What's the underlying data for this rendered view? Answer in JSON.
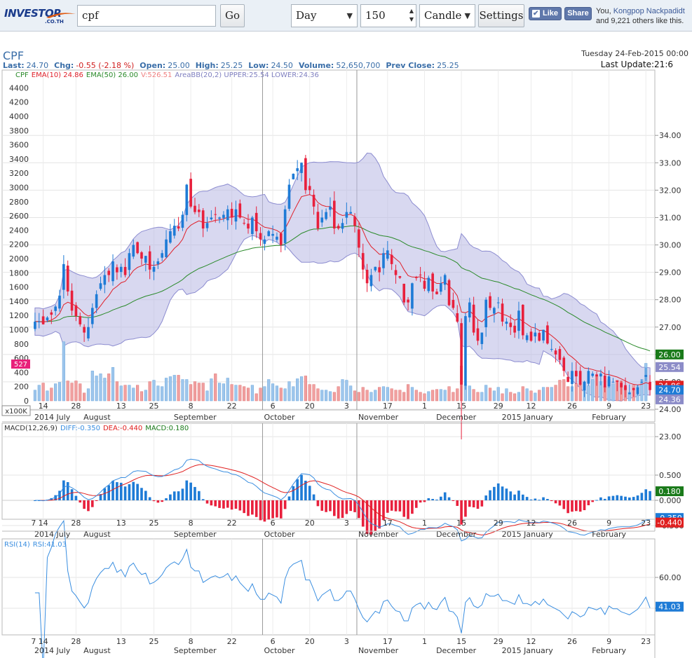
{
  "toolbar": {
    "logo_main": "INVESTOR",
    "logo_sub": ".CO.TH",
    "symbol_value": "cpf",
    "go_label": "Go",
    "period_value": "Day",
    "bars_value": "150",
    "style_value": "Candle",
    "settings_label": "Settings",
    "like_label": "Like",
    "share_label": "Share",
    "social_you": "You,",
    "social_name": "Kongpop Nackpadidt",
    "social_rest": "and 9,221 others like this."
  },
  "colors": {
    "up": "#1e7bd6",
    "down": "#e8203c",
    "ema10": "#e0202a",
    "ema50": "#2a8a2a",
    "band_fill": "#b8b8e4",
    "band_stroke": "#8c8cd0",
    "vol_up": "#9ec6ec",
    "vol_down": "#f0a0a0",
    "diff": "#3a8ee0",
    "dea": "#e02020",
    "rsi": "#3a8ee0",
    "header_text": "#3a6ea8"
  },
  "header": {
    "symbol": "CPF",
    "date": "Tuesday 24-Feb-2015 00:00",
    "last_update": "Last Update:21:6",
    "stats": [
      {
        "label": "Last:",
        "value": "24.70"
      },
      {
        "label": "Chg:",
        "value": "-0.55 (-2.18 %)",
        "negative": true
      },
      {
        "label": "Open:",
        "value": "25.00"
      },
      {
        "label": "High:",
        "value": "25.25"
      },
      {
        "label": "Low:",
        "value": "24.50"
      },
      {
        "label": "Volume:",
        "value": "52,650,700"
      },
      {
        "label": "Prev Close:",
        "value": "25.25"
      }
    ]
  },
  "price_panel": {
    "legend": [
      {
        "text": "CPF",
        "color": "#2a8a2a"
      },
      {
        "text": "EMA(10) 24.86",
        "color": "#e0202a"
      },
      {
        "text": "EMA(50) 26.00",
        "color": "#2a8a2a"
      },
      {
        "text": "V:526.51",
        "color": "#f08080"
      },
      {
        "text": "AreaBB(20,2) UPPER:25.54 LOWER:24.36",
        "color": "#8080c0"
      }
    ],
    "price_ticks": [
      "34.00",
      "33.00",
      "32.00",
      "31.00",
      "30.00",
      "29.00",
      "28.00",
      "27.00",
      "26.00",
      "25.00",
      "24.00",
      "23.00"
    ],
    "volume_ticks": [
      "4400",
      "4200",
      "4000",
      "3800",
      "3600",
      "3400",
      "3200",
      "3000",
      "2800",
      "2600",
      "2400",
      "2200",
      "2000",
      "1800",
      "1600",
      "1400",
      "1200",
      "1000",
      "800",
      "600",
      "400",
      "200",
      "0"
    ],
    "volume_unit": "x100K",
    "volume_badge": "527",
    "tags": [
      {
        "text": "26.00",
        "value": 26.0,
        "bg": "#1a7a1a"
      },
      {
        "text": "25.54",
        "value": 25.54,
        "bg": "#8c8cc8"
      },
      {
        "text": "24.86",
        "value": 24.86,
        "bg": "#e02020"
      },
      {
        "text": "24.70",
        "value": 24.7,
        "bg": "#1e7bd6"
      },
      {
        "text": "24.36",
        "value": 24.36,
        "bg": "#8c8cc8"
      }
    ]
  },
  "macd_panel": {
    "legend": [
      {
        "text": "MACD(12,26,9)",
        "color": "#333333"
      },
      {
        "text": "DIFF:-0.350",
        "color": "#3a8ee0"
      },
      {
        "text": "DEA:-0.440",
        "color": "#e02020"
      },
      {
        "text": "MACD:0.180",
        "color": "#1a7a1a"
      }
    ],
    "ticks": [
      "0.500",
      "0.000",
      "-0.500"
    ],
    "tags": [
      {
        "text": "0.180",
        "value": 0.18,
        "bg": "#1a7a1a"
      },
      {
        "text": "-0.350",
        "value": -0.35,
        "bg": "#1e7bd6"
      },
      {
        "text": "-0.440",
        "value": -0.44,
        "bg": "#e02020"
      }
    ]
  },
  "rsi_panel": {
    "legend": [
      {
        "text": "RSI(14)",
        "color": "#3a8ee0"
      },
      {
        "text": "RSI:41.03",
        "color": "#3a8ee0"
      }
    ],
    "ticks": [
      "60.00",
      "40.00"
    ],
    "tags": [
      {
        "text": "41.03",
        "value": 41.03,
        "bg": "#1e7bd6"
      }
    ]
  },
  "time_axis": {
    "day_labels": [
      {
        "text": "14",
        "i": 2
      },
      {
        "text": "28",
        "i": 10
      },
      {
        "text": "13",
        "i": 21
      },
      {
        "text": "25",
        "i": 29
      },
      {
        "text": "8",
        "i": 38
      },
      {
        "text": "22",
        "i": 48
      },
      {
        "text": "6",
        "i": 58
      },
      {
        "text": "20",
        "i": 67
      },
      {
        "text": "3",
        "i": 76
      },
      {
        "text": "17",
        "i": 86
      },
      {
        "text": "1",
        "i": 95
      },
      {
        "text": "15",
        "i": 104
      },
      {
        "text": "29",
        "i": 113
      },
      {
        "text": "12",
        "i": 121
      },
      {
        "text": "26",
        "i": 131
      },
      {
        "text": "9",
        "i": 140
      },
      {
        "text": "23",
        "i": 149
      }
    ],
    "lead_label": {
      "text": "7",
      "i": 0
    },
    "month_labels": [
      {
        "text": "2014 July",
        "i": 0
      },
      {
        "text": "August",
        "i": 12
      },
      {
        "text": "September",
        "i": 34
      },
      {
        "text": "October",
        "i": 56
      },
      {
        "text": "November",
        "i": 79
      },
      {
        "text": "December",
        "i": 98
      },
      {
        "text": "2015 January",
        "i": 114
      },
      {
        "text": "February",
        "i": 136
      }
    ],
    "separators": [
      56,
      79
    ]
  },
  "chart_data": {
    "type": "candlestick",
    "symbol": "CPF",
    "x": [
      "2014-07-07",
      "2015-02-24"
    ],
    "series": [
      {
        "name": "EMA(10)",
        "last": 24.86
      },
      {
        "name": "EMA(50)",
        "last": 26.0
      },
      {
        "name": "AreaBB(20,2)",
        "upper_last": 25.54,
        "lower_last": 24.36
      }
    ],
    "closes": [
      27.2,
      27.2,
      27.1,
      27.35,
      27.45,
      27.75,
      28.15,
      29.3,
      28.3,
      27.6,
      27.4,
      27.1,
      26.8,
      27.0,
      27.7,
      28.2,
      28.6,
      28.9,
      28.9,
      29.4,
      29.0,
      29.2,
      28.9,
      29.7,
      30.0,
      29.7,
      29.5,
      29.6,
      29.1,
      29.2,
      29.4,
      29.7,
      30.2,
      30.5,
      30.7,
      30.6,
      31.1,
      32.2,
      31.4,
      31.2,
      31.2,
      30.6,
      30.8,
      31.0,
      31.1,
      31.0,
      31.1,
      31.3,
      31.0,
      31.3,
      31.0,
      30.8,
      30.6,
      31.0,
      30.5,
      30.2,
      30.2,
      30.5,
      30.4,
      30.3,
      30.0,
      31.3,
      32.2,
      32.6,
      32.8,
      33.0,
      32.0,
      32.0,
      31.4,
      30.6,
      31.0,
      31.2,
      31.4,
      30.6,
      30.6,
      30.8,
      31.2,
      31.2,
      30.7,
      29.9,
      29.1,
      28.6,
      28.9,
      29.2,
      29.0,
      29.7,
      29.8,
      29.3,
      28.9,
      28.8,
      27.9,
      27.9,
      28.6,
      28.8,
      28.9,
      28.4,
      28.8,
      28.3,
      28.2,
      28.6,
      28.9,
      27.8,
      27.7,
      27.2,
      24.9,
      27.4,
      27.9,
      26.8,
      26.5,
      26.8,
      28.0,
      27.7,
      27.7,
      27.9,
      27.2,
      27.2,
      27.0,
      26.8,
      27.6,
      26.7,
      26.7,
      26.5,
      26.8,
      26.5,
      26.9,
      26.4,
      26.2,
      26.0,
      25.8,
      25.4,
      25.0,
      25.4,
      25.2,
      24.9,
      25.0,
      25.4,
      25.3,
      25.2,
      25.3,
      24.8,
      25.2,
      25.0,
      25.0,
      24.8,
      24.7,
      24.6,
      24.7,
      24.8,
      25.0,
      25.25,
      24.7
    ],
    "volume_x100k": [
      150,
      220,
      250,
      140,
      180,
      240,
      260,
      830,
      280,
      250,
      280,
      240,
      110,
      170,
      420,
      350,
      380,
      320,
      380,
      470,
      270,
      210,
      220,
      220,
      180,
      220,
      130,
      150,
      270,
      290,
      210,
      200,
      320,
      340,
      360,
      360,
      300,
      300,
      230,
      270,
      250,
      250,
      140,
      310,
      380,
      250,
      240,
      320,
      230,
      220,
      220,
      200,
      180,
      220,
      100,
      180,
      200,
      300,
      240,
      210,
      180,
      170,
      270,
      200,
      310,
      340,
      350,
      230,
      230,
      170,
      150,
      150,
      130,
      120,
      200,
      300,
      290,
      210,
      140,
      120,
      190,
      150,
      120,
      150,
      190,
      200,
      190,
      170,
      150,
      150,
      120,
      230,
      190,
      150,
      120,
      100,
      130,
      150,
      160,
      160,
      150,
      200,
      120,
      170,
      490,
      220,
      210,
      160,
      120,
      120,
      220,
      180,
      140,
      190,
      100,
      170,
      120,
      100,
      120,
      200,
      170,
      140,
      110,
      150,
      190,
      190,
      190,
      220,
      290,
      300,
      200,
      200,
      240,
      240,
      270,
      210,
      300,
      350,
      270,
      200,
      300,
      240,
      290,
      280,
      190,
      120,
      220,
      210,
      300,
      527
    ],
    "macd_last": {
      "diff": -0.35,
      "dea": -0.44,
      "macd": 0.18
    },
    "rsi_last": 41.03,
    "ylim": [
      22.5,
      34.3
    ],
    "volume_ylim": [
      0,
      4580
    ]
  }
}
